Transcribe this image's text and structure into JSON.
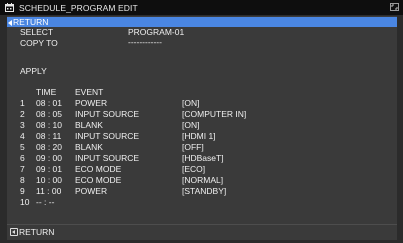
{
  "title": "SCHEDULE_PROGRAM EDIT",
  "menu": {
    "return_label": "RETURN",
    "select_label": "SELECT",
    "select_value": "PROGRAM-01",
    "copy_label": "COPY TO",
    "copy_value": "------------",
    "apply_label": "APPLY"
  },
  "table": {
    "headers": {
      "time": "TIME",
      "event": "EVENT"
    },
    "rows": [
      {
        "num": "1",
        "time": "08 : 01",
        "event": "POWER",
        "value": "[ON]"
      },
      {
        "num": "2",
        "time": "08 : 05",
        "event": "INPUT SOURCE",
        "value": "[COMPUTER IN]"
      },
      {
        "num": "3",
        "time": "08 : 10",
        "event": "BLANK",
        "value": "[ON]"
      },
      {
        "num": "4",
        "time": "08 : 11",
        "event": "INPUT SOURCE",
        "value": "[HDMI 1]"
      },
      {
        "num": "5",
        "time": "08 : 20",
        "event": "BLANK",
        "value": "[OFF]"
      },
      {
        "num": "6",
        "time": "09 : 00",
        "event": "INPUT SOURCE",
        "value": "[HDBaseT]"
      },
      {
        "num": "7",
        "time": "09 : 01",
        "event": "ECO MODE",
        "value": "[ECO]"
      },
      {
        "num": "8",
        "time": "10 : 00",
        "event": "ECO MODE",
        "value": "[NORMAL]"
      },
      {
        "num": "9",
        "time": "11 : 00",
        "event": "POWER",
        "value": "[STANDBY]"
      },
      {
        "num": "10",
        "time": "-- : --",
        "event": "",
        "value": ""
      }
    ]
  },
  "footer": {
    "return_label": "RETURN"
  },
  "colors": {
    "highlight": "#4a86e2",
    "panel": "#3a3a3a",
    "titlebar": "#0e0e0e"
  }
}
